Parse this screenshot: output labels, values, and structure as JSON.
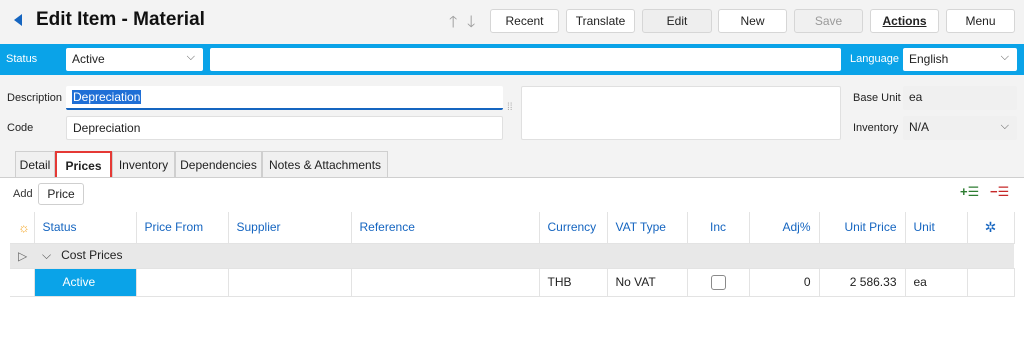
{
  "header": {
    "title": "Edit Item - Material",
    "buttons": {
      "recent": "Recent",
      "translate": "Translate",
      "edit": "Edit",
      "new": "New",
      "save": "Save",
      "actions": "Actions",
      "menu": "Menu"
    }
  },
  "statusbar": {
    "status_label": "Status",
    "status_value": "Active",
    "middle_value": "",
    "language_label": "Language",
    "language_value": "English"
  },
  "form": {
    "description_label": "Description",
    "description_value": "Depreciation",
    "code_label": "Code",
    "code_value": "Depreciation",
    "base_unit_label": "Base Unit",
    "base_unit_value": "ea",
    "inventory_label": "Inventory",
    "inventory_value": "N/A"
  },
  "tabs": [
    {
      "label": "Detail"
    },
    {
      "label": "Prices"
    },
    {
      "label": "Inventory"
    },
    {
      "label": "Dependencies"
    },
    {
      "label": "Notes & Attachments"
    }
  ],
  "prices": {
    "add_label": "Add",
    "add_button": "Price",
    "columns": [
      "Status",
      "Price From",
      "Supplier",
      "Reference",
      "Currency",
      "VAT Type",
      "Inc",
      "Adj%",
      "Unit Price",
      "Unit"
    ],
    "group_label": "Cost Prices",
    "row": {
      "status": "Active",
      "price_from": "",
      "supplier": "",
      "reference": "",
      "currency": "THB",
      "vat_type": "No VAT",
      "inc": false,
      "adj": "0",
      "unit_price": "2 586.33",
      "unit": "ea"
    }
  },
  "colors": {
    "accent": "#0aa3e8",
    "link": "#1565c0",
    "highlight_tab_border": "#e53935"
  }
}
